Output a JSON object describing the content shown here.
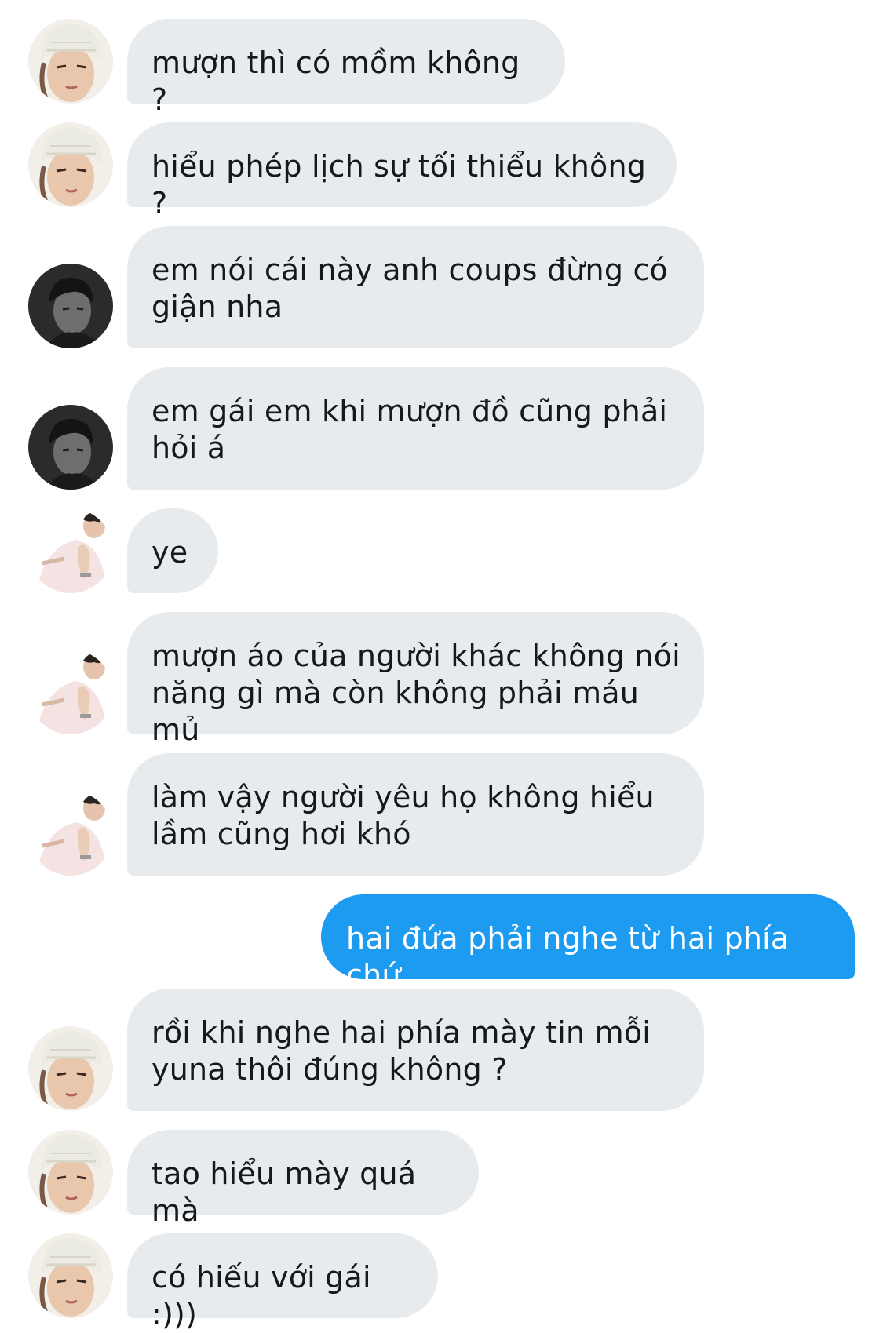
{
  "messages": [
    {
      "sender": "beanie",
      "text": "mượn thì có mồm không ?"
    },
    {
      "sender": "beanie",
      "text": "hiểu phép lịch sự tối thiểu không ?"
    },
    {
      "sender": "dark",
      "text": "em nói cái này anh coups đừng có giận nha"
    },
    {
      "sender": "dark",
      "text": "em gái em khi mượn đồ cũng phải hỏi á"
    },
    {
      "sender": "pink",
      "text": "ye"
    },
    {
      "sender": "pink",
      "text": "mượn áo của người khác không nói năng gì mà còn không phải máu mủ"
    },
    {
      "sender": "pink",
      "text": "làm vậy người yêu họ không hiểu lầm cũng hơi khó"
    },
    {
      "sender": "me",
      "text": "hai đứa phải nghe từ hai phía chứ"
    },
    {
      "sender": "beanie",
      "text": "rồi khi nghe hai phía mày tin mỗi yuna thôi đúng không ?"
    },
    {
      "sender": "beanie",
      "text": "tao hiểu mày quá mà"
    },
    {
      "sender": "beanie",
      "text": "có hiếu với gái :)))"
    }
  ],
  "colors": {
    "received_bubble": "#e8ebee",
    "sent_bubble": "#1d9bf0",
    "received_text": "#16181b",
    "sent_text": "#ffffff"
  }
}
